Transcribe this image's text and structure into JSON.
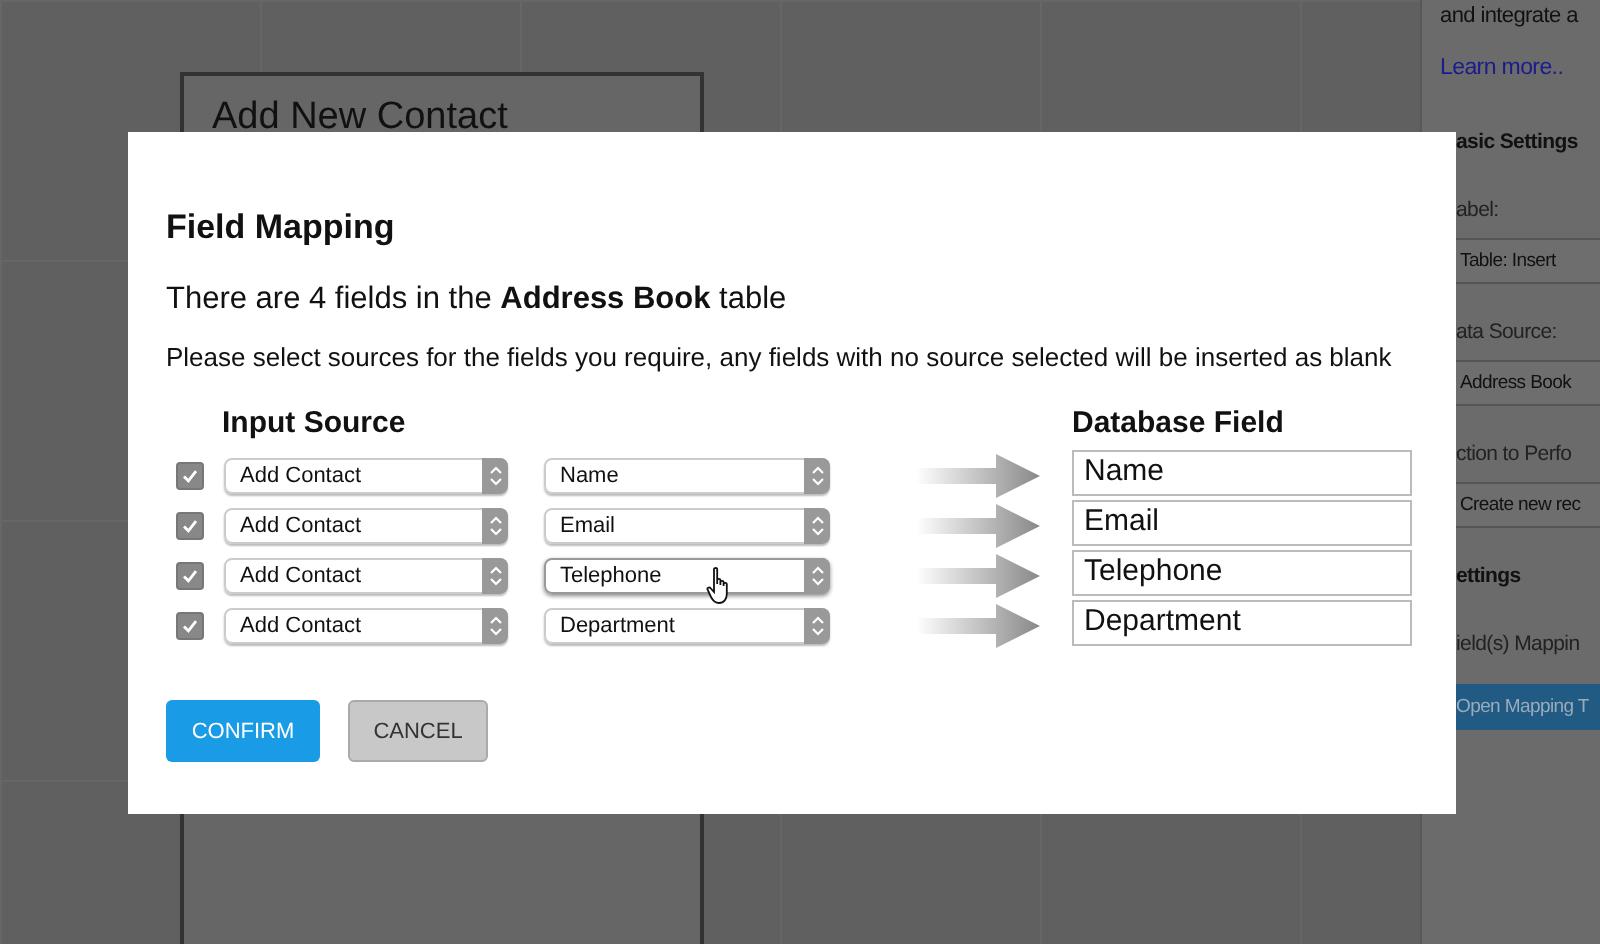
{
  "background": {
    "card_title": "Add New Contact",
    "sidebar": {
      "intro": "and integrate a",
      "link": "Learn more..",
      "items": [
        {
          "kind": "heading",
          "text": "asic Settings"
        },
        {
          "kind": "label",
          "text": "abel:"
        },
        {
          "kind": "input",
          "text": "Table: Insert"
        },
        {
          "kind": "label",
          "text": "ata Source:"
        },
        {
          "kind": "input",
          "text": "Address Book"
        },
        {
          "kind": "label",
          "text": "ction to Perfo"
        },
        {
          "kind": "input",
          "text": "Create new rec"
        },
        {
          "kind": "heading",
          "text": "ettings"
        },
        {
          "kind": "label",
          "text": "ield(s) Mappin"
        },
        {
          "kind": "button",
          "text": "Open Mapping T"
        }
      ]
    }
  },
  "dialog": {
    "title": "Field Mapping",
    "summary": "There are 4 fields in the **Address Book** table",
    "instruction": "Please select sources for the fields you require, any fields with no source selected will be inserted as blank",
    "input_heading": "Input Source",
    "database_heading": "Database Field",
    "rows": [
      {
        "checked": true,
        "source": "Add Contact",
        "source_field": "Name",
        "database_field": "Name",
        "hovered": false
      },
      {
        "checked": true,
        "source": "Add Contact",
        "source_field": "Email",
        "database_field": "Email",
        "hovered": false
      },
      {
        "checked": true,
        "source": "Add Contact",
        "source_field": "Telephone",
        "database_field": "Telephone",
        "hovered": true
      },
      {
        "checked": true,
        "source": "Add Contact",
        "source_field": "Department",
        "database_field": "Department",
        "hovered": false
      }
    ],
    "buttons": [
      {
        "kind": "primary",
        "label": "CONFIRM"
      },
      {
        "kind": "secondary",
        "label": "CANCEL"
      }
    ]
  }
}
